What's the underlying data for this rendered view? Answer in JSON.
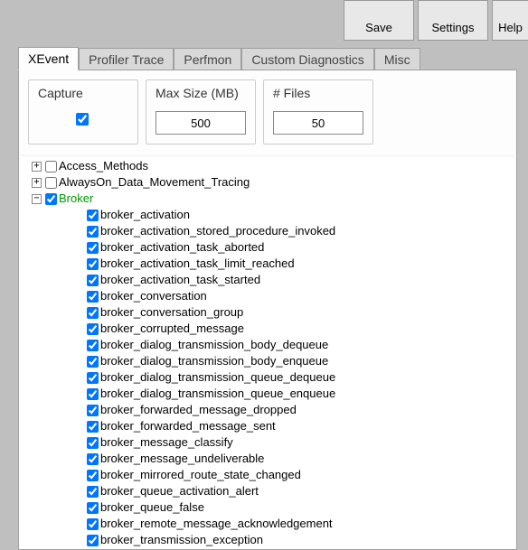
{
  "toolbar": {
    "save": "Save",
    "settings": "Settings",
    "help": "Help"
  },
  "tabs": [
    {
      "label": "XEvent",
      "active": true
    },
    {
      "label": "Profiler Trace",
      "active": false
    },
    {
      "label": "Perfmon",
      "active": false
    },
    {
      "label": "Custom Diagnostics",
      "active": false
    },
    {
      "label": "Misc",
      "active": false
    }
  ],
  "options": {
    "capture": {
      "label": "Capture",
      "checked": true
    },
    "maxSize": {
      "label": "Max Size (MB)",
      "value": "500"
    },
    "numFiles": {
      "label": "# Files",
      "value": "50"
    }
  },
  "tree": [
    {
      "level": 0,
      "expander": "plus",
      "checked": false,
      "label": "Access_Methods"
    },
    {
      "level": 0,
      "expander": "plus",
      "checked": false,
      "label": "AlwaysOn_Data_Movement_Tracing"
    },
    {
      "level": 0,
      "expander": "minus",
      "checked": true,
      "label": "Broker",
      "highlight": true
    },
    {
      "level": 2,
      "expander": "none",
      "checked": true,
      "label": "broker_activation"
    },
    {
      "level": 2,
      "expander": "none",
      "checked": true,
      "label": "broker_activation_stored_procedure_invoked"
    },
    {
      "level": 2,
      "expander": "none",
      "checked": true,
      "label": "broker_activation_task_aborted"
    },
    {
      "level": 2,
      "expander": "none",
      "checked": true,
      "label": "broker_activation_task_limit_reached"
    },
    {
      "level": 2,
      "expander": "none",
      "checked": true,
      "label": "broker_activation_task_started"
    },
    {
      "level": 2,
      "expander": "none",
      "checked": true,
      "label": "broker_conversation"
    },
    {
      "level": 2,
      "expander": "none",
      "checked": true,
      "label": "broker_conversation_group"
    },
    {
      "level": 2,
      "expander": "none",
      "checked": true,
      "label": "broker_corrupted_message"
    },
    {
      "level": 2,
      "expander": "none",
      "checked": true,
      "label": "broker_dialog_transmission_body_dequeue"
    },
    {
      "level": 2,
      "expander": "none",
      "checked": true,
      "label": "broker_dialog_transmission_body_enqueue"
    },
    {
      "level": 2,
      "expander": "none",
      "checked": true,
      "label": "broker_dialog_transmission_queue_dequeue"
    },
    {
      "level": 2,
      "expander": "none",
      "checked": true,
      "label": "broker_dialog_transmission_queue_enqueue"
    },
    {
      "level": 2,
      "expander": "none",
      "checked": true,
      "label": "broker_forwarded_message_dropped"
    },
    {
      "level": 2,
      "expander": "none",
      "checked": true,
      "label": "broker_forwarded_message_sent"
    },
    {
      "level": 2,
      "expander": "none",
      "checked": true,
      "label": "broker_message_classify"
    },
    {
      "level": 2,
      "expander": "none",
      "checked": true,
      "label": "broker_message_undeliverable"
    },
    {
      "level": 2,
      "expander": "none",
      "checked": true,
      "label": "broker_mirrored_route_state_changed"
    },
    {
      "level": 2,
      "expander": "none",
      "checked": true,
      "label": "broker_queue_activation_alert"
    },
    {
      "level": 2,
      "expander": "none",
      "checked": true,
      "label": "broker_queue_false"
    },
    {
      "level": 2,
      "expander": "none",
      "checked": true,
      "label": "broker_remote_message_acknowledgement"
    },
    {
      "level": 2,
      "expander": "none",
      "checked": true,
      "label": "broker_transmission_exception"
    }
  ]
}
